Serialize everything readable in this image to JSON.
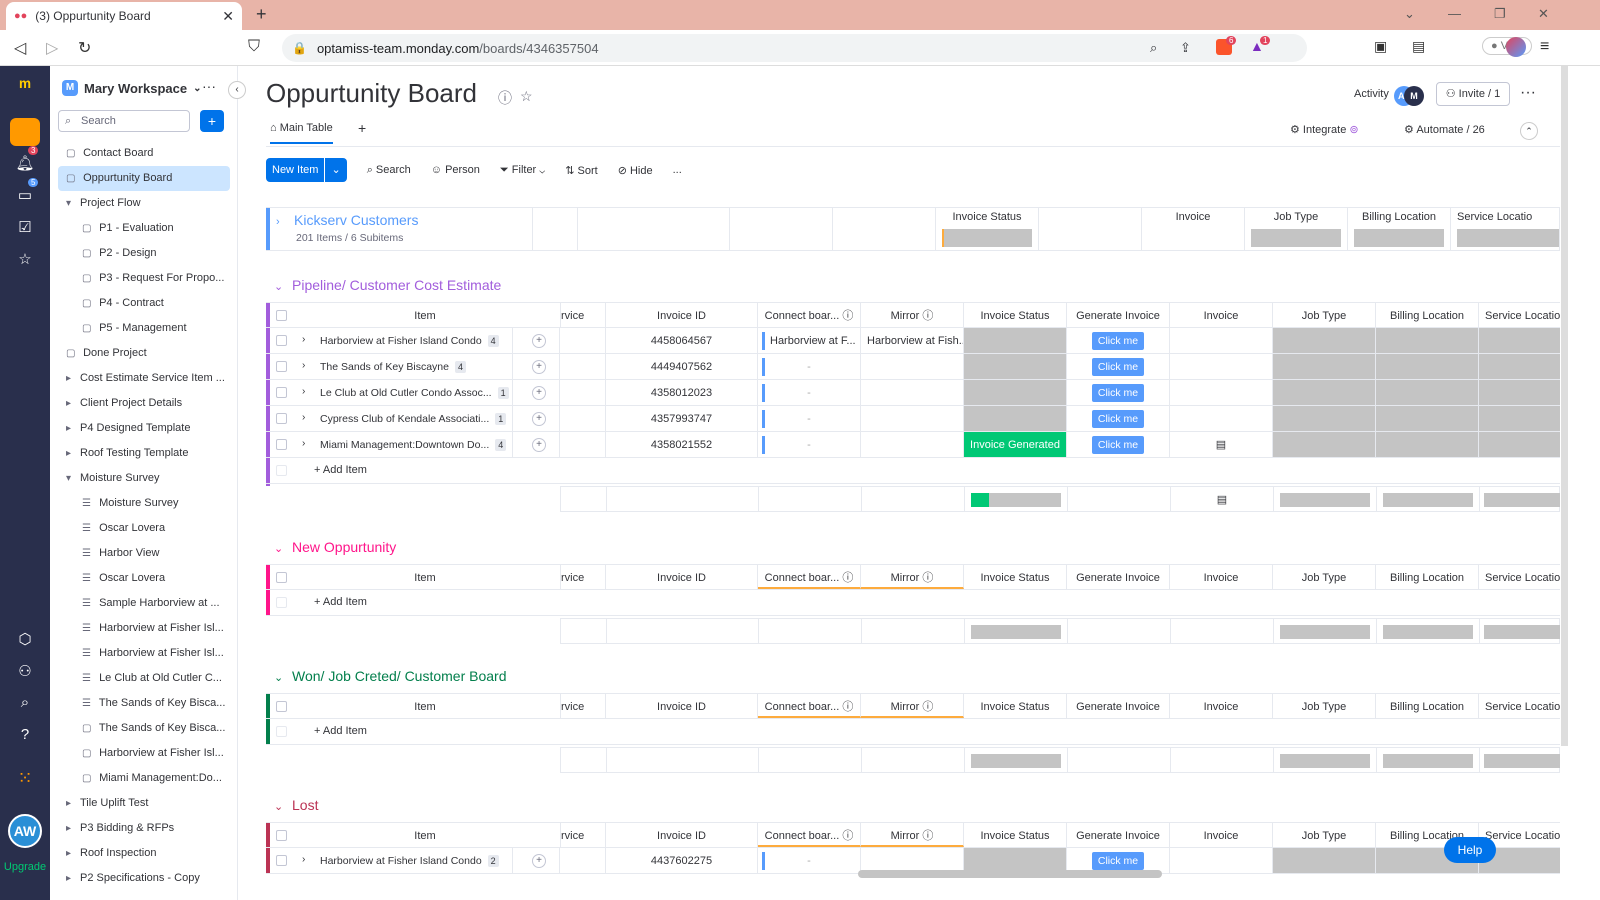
{
  "browser": {
    "tab_title": "(3) Oppurtunity Board",
    "url_host": "optamiss-team.monday.com",
    "url_path": "/boards/4346357504",
    "vpn_label": "VPN",
    "brave_count": "6",
    "alert_count": "1"
  },
  "rail": {
    "notif_badge": "3",
    "inbox_badge": "5",
    "avatar": "AW",
    "upgrade": "Upgrade"
  },
  "sidebar": {
    "workspace": "Mary Workspace",
    "ws_letter": "M",
    "search_placeholder": "Search",
    "items": [
      {
        "label": "Contact Board"
      },
      {
        "label": "Oppurtunity Board"
      },
      {
        "label": "Project Flow"
      },
      {
        "label": "P1 - Evaluation"
      },
      {
        "label": "P2 - Design"
      },
      {
        "label": "P3 - Request For Propo..."
      },
      {
        "label": "P4 - Contract"
      },
      {
        "label": "P5 - Management"
      },
      {
        "label": "Done Project"
      },
      {
        "label": "Cost Estimate Service Item ..."
      },
      {
        "label": "Client Project Details"
      },
      {
        "label": "P4 Designed Template"
      },
      {
        "label": "Roof Testing Template"
      },
      {
        "label": "Moisture Survey"
      },
      {
        "label": "Moisture Survey"
      },
      {
        "label": "Oscar Lovera"
      },
      {
        "label": "Harbor View"
      },
      {
        "label": "Oscar Lovera"
      },
      {
        "label": "Sample Harborview at ..."
      },
      {
        "label": "Harborview at Fisher Isl..."
      },
      {
        "label": "Harborview at Fisher Isl..."
      },
      {
        "label": "Le Club at Old Cutler C..."
      },
      {
        "label": "The Sands of Key Bisca..."
      },
      {
        "label": "The Sands of Key Bisca..."
      },
      {
        "label": "Harborview at Fisher Isl..."
      },
      {
        "label": "Miami Management:Do..."
      },
      {
        "label": "Tile Uplift Test"
      },
      {
        "label": "P3 Bidding & RFPs"
      },
      {
        "label": "Roof Inspection"
      },
      {
        "label": "P2 Specifications - Copy"
      }
    ]
  },
  "header": {
    "title": "Oppurtunity Board",
    "activity": "Activity",
    "invite": "Invite / 1",
    "tab_main": "Main Table",
    "integrate": "Integrate",
    "automate": "Automate / 26",
    "avatar1": "AL",
    "avatar2": "M"
  },
  "toolbar": {
    "new_item": "New Item",
    "search": "Search",
    "person": "Person",
    "filter": "Filter",
    "sort": "Sort",
    "hide": "Hide",
    "more": "..."
  },
  "columns": {
    "item": "Item",
    "service": "rvice",
    "invoice_id": "Invoice ID",
    "connect": "Connect boar...",
    "mirror": "Mirror",
    "invoice_status": "Invoice Status",
    "generate_invoice": "Generate Invoice",
    "invoice": "Invoice",
    "job_type": "Job Type",
    "billing_location": "Billing Location",
    "service_location": "Service Locatio"
  },
  "groups": {
    "kickserv": {
      "title": "Kickserv Customers",
      "count": "201 Items / 6 Subitems",
      "color": "#579bfc"
    },
    "pipeline": {
      "title": "Pipeline/ Customer Cost Estimate",
      "color": "#a25ddc",
      "rows": [
        {
          "name": "Harborview at Fisher Island Condo",
          "sub": "4",
          "invoice_id": "4458064567",
          "connect": "Harborview at F...",
          "mirror": "Harborview at Fish...",
          "status": "",
          "button": "Click me"
        },
        {
          "name": "The Sands of Key Biscayne",
          "sub": "4",
          "invoice_id": "4449407562",
          "connect": "-",
          "mirror": "",
          "status": "",
          "button": "Click me"
        },
        {
          "name": "Le Club at Old Cutler Condo Assoc...",
          "sub": "1",
          "invoice_id": "4358012023",
          "connect": "-",
          "mirror": "",
          "status": "",
          "button": "Click me"
        },
        {
          "name": "Cypress Club of Kendale Associati...",
          "sub": "1",
          "invoice_id": "4357993747",
          "connect": "-",
          "mirror": "",
          "status": "",
          "button": "Click me"
        },
        {
          "name": "Miami Management:Downtown Do...",
          "sub": "4",
          "invoice_id": "4358021552",
          "connect": "-",
          "mirror": "",
          "status": "Invoice Generated",
          "button": "Click me"
        }
      ]
    },
    "new": {
      "title": "New Oppurtunity",
      "color": "#ff158a"
    },
    "won": {
      "title": "Won/ Job Creted/ Customer Board",
      "color": "#037f4c"
    },
    "lost": {
      "title": "Lost",
      "color": "#bb3354",
      "rows": [
        {
          "name": "Harborview at Fisher Island Condo",
          "sub": "2",
          "invoice_id": "4437602275",
          "connect": "-",
          "button": "Click me"
        }
      ]
    },
    "add_item": "+ Add Item"
  },
  "help": "Help"
}
